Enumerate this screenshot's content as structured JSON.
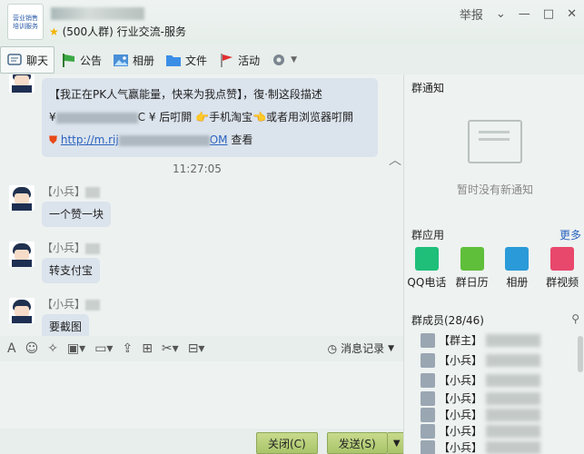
{
  "window": {
    "group_meta": "(500人群) 行业交流-服务",
    "controls": [
      "举报",
      "⌄",
      "—",
      "□",
      "✕"
    ]
  },
  "toolbar": [
    {
      "label": "聊天",
      "icon": "chat-icon",
      "active": true
    },
    {
      "label": "公告",
      "icon": "announcement-flag-icon"
    },
    {
      "label": "相册",
      "icon": "photo-album-icon"
    },
    {
      "label": "文件",
      "icon": "folder-icon"
    },
    {
      "label": "活动",
      "icon": "activity-flag-icon"
    }
  ],
  "messages": {
    "first": {
      "line1": "【我正在PK人气赢能量，快来为我点赞】，復·制这段描述",
      "line2a": "¥",
      "line2b": "C ¥ 后咑閞",
      "line2c": "手机淘宝",
      "line2d": "或者用浏览器咑閞",
      "link": "http://m.rij",
      "link_end": "OM",
      "view": "查看"
    },
    "time": "11:27:05",
    "list": [
      {
        "sender": "【小兵】",
        "text": "一个赞一块"
      },
      {
        "sender": "【小兵】",
        "text": "转支付宝"
      },
      {
        "sender": "【小兵】",
        "text": "要截图"
      }
    ]
  },
  "input_toolbar": {
    "history_label": "消息记录"
  },
  "buttons": {
    "close": "关闭(C)",
    "send": "发送(S)"
  },
  "sidebar": {
    "notice_title": "群通知",
    "notice_empty": "暂时没有新通知",
    "apps_title": "群应用",
    "more": "更多",
    "apps": [
      {
        "label": "QQ电话",
        "color": "#1fbf7a"
      },
      {
        "label": "群日历",
        "color": "#5fbf3a"
      },
      {
        "label": "相册",
        "color": "#2a9ad8"
      },
      {
        "label": "群视频",
        "color": "#e8486c"
      }
    ],
    "members_title": "群成员(28/46)",
    "members": [
      "【群主】",
      "【小兵】",
      "【小兵】",
      "【小兵】",
      "【小兵】",
      "【小兵】",
      "【小兵】"
    ]
  }
}
